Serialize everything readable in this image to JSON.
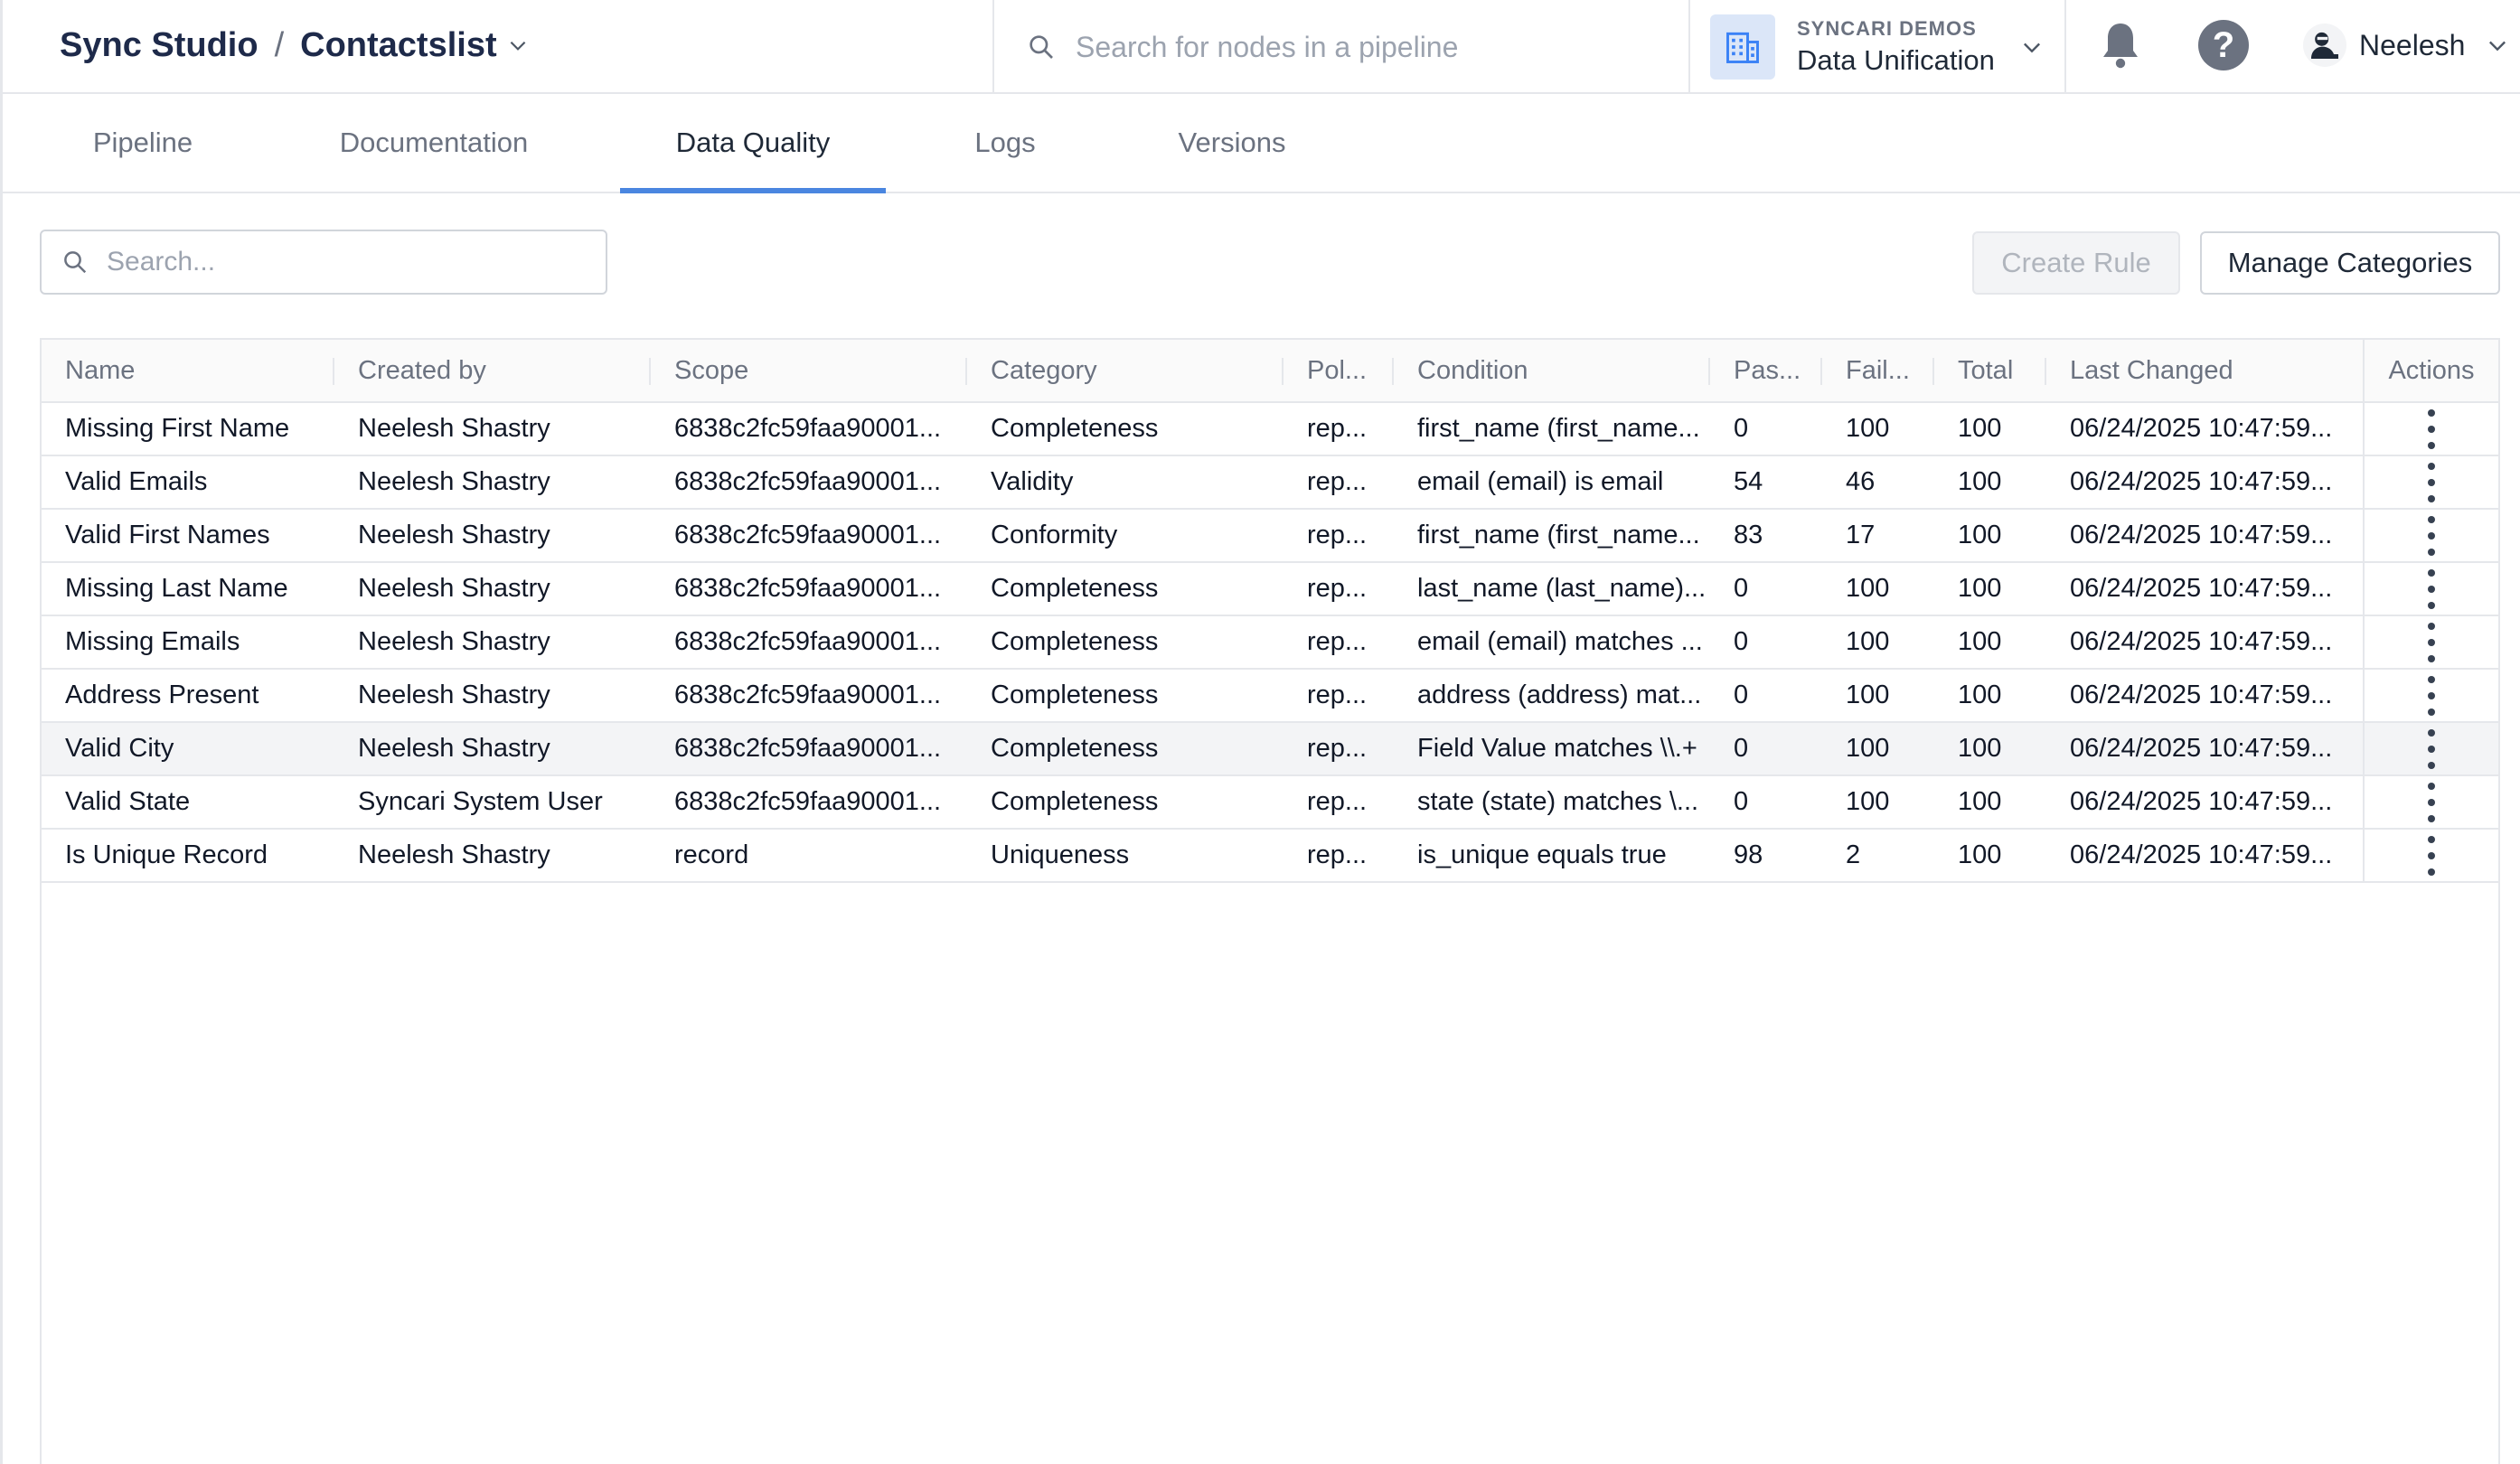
{
  "header": {
    "app_name": "Sync Studio",
    "separator": "/",
    "pipeline_name": "Contactslist",
    "node_search_placeholder": "Search for nodes in a pipeline",
    "org_label": "SYNCARI DEMOS",
    "org_name": "Data Unification",
    "user_name": "Neelesh"
  },
  "tabs": [
    {
      "label": "Pipeline",
      "active": false
    },
    {
      "label": "Documentation",
      "active": false
    },
    {
      "label": "Data Quality",
      "active": true
    },
    {
      "label": "Logs",
      "active": false
    },
    {
      "label": "Versions",
      "active": false
    }
  ],
  "toolbar": {
    "search_placeholder": "Search...",
    "create_rule_label": "Create Rule",
    "create_rule_disabled": true,
    "manage_categories_label": "Manage Categories"
  },
  "table": {
    "columns": [
      "Name",
      "Created by",
      "Scope",
      "Category",
      "Pol...",
      "Condition",
      "Pas...",
      "Fail...",
      "Total",
      "Last Changed",
      "Actions"
    ],
    "rows": [
      [
        "Missing First Name",
        "Neelesh Shastry",
        "6838c2fc59faa90001...",
        "Completeness",
        "rep...",
        "first_name (first_name...",
        "0",
        "100",
        "100",
        "06/24/2025 10:47:59..."
      ],
      [
        "Valid Emails",
        "Neelesh Shastry",
        "6838c2fc59faa90001...",
        "Validity",
        "rep...",
        "email (email) is email",
        "54",
        "46",
        "100",
        "06/24/2025 10:47:59..."
      ],
      [
        "Valid First Names",
        "Neelesh Shastry",
        "6838c2fc59faa90001...",
        "Conformity",
        "rep...",
        "first_name (first_name...",
        "83",
        "17",
        "100",
        "06/24/2025 10:47:59..."
      ],
      [
        "Missing Last Name",
        "Neelesh Shastry",
        "6838c2fc59faa90001...",
        "Completeness",
        "rep...",
        "last_name (last_name)...",
        "0",
        "100",
        "100",
        "06/24/2025 10:47:59..."
      ],
      [
        "Missing Emails",
        "Neelesh Shastry",
        "6838c2fc59faa90001...",
        "Completeness",
        "rep...",
        "email (email) matches ...",
        "0",
        "100",
        "100",
        "06/24/2025 10:47:59..."
      ],
      [
        "Address Present",
        "Neelesh Shastry",
        "6838c2fc59faa90001...",
        "Completeness",
        "rep...",
        "address (address) mat...",
        "0",
        "100",
        "100",
        "06/24/2025 10:47:59..."
      ],
      [
        "Valid City",
        "Neelesh Shastry",
        "6838c2fc59faa90001...",
        "Completeness",
        "rep...",
        "Field Value matches \\\\.+",
        "0",
        "100",
        "100",
        "06/24/2025 10:47:59..."
      ],
      [
        "Valid State",
        "Syncari System User",
        "6838c2fc59faa90001...",
        "Completeness",
        "rep...",
        "state (state) matches \\...",
        "0",
        "100",
        "100",
        "06/24/2025 10:47:59..."
      ],
      [
        "Is Unique Record",
        "Neelesh Shastry",
        "record",
        "Uniqueness",
        "rep...",
        "is_unique equals true",
        "98",
        "2",
        "100",
        "06/24/2025 10:47:59..."
      ]
    ],
    "highlighted_row": 6
  },
  "colors": {
    "accent": "#4a86e0",
    "brand_text": "#1e2a4a"
  },
  "icons": {
    "node_search": "search-icon",
    "org": "building-icon",
    "notifications": "bell-icon",
    "help": "help-icon",
    "user": "avatar",
    "row_actions": "kebab-menu-icon"
  }
}
